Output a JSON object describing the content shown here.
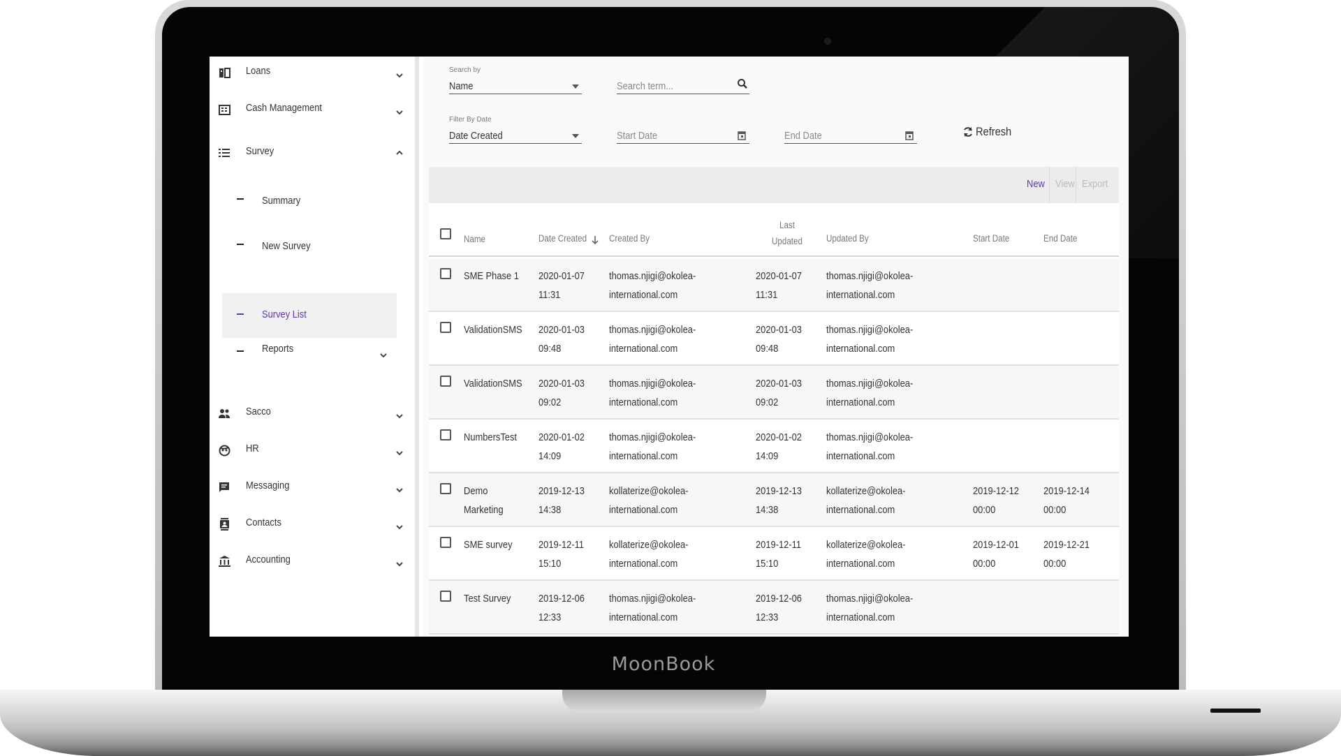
{
  "device": {
    "brand": "MoonBook"
  },
  "sidebar": {
    "items": [
      {
        "label": "Loans",
        "icon": "loans-book-icon"
      },
      {
        "label": "Cash Management",
        "icon": "cash-register-icon"
      },
      {
        "label": "Survey",
        "icon": "list-icon",
        "expanded": true
      },
      {
        "label": "Sacco",
        "icon": "group-icon"
      },
      {
        "label": "HR",
        "icon": "face-icon"
      },
      {
        "label": "Messaging",
        "icon": "message-icon"
      },
      {
        "label": "Contacts",
        "icon": "contacts-icon"
      },
      {
        "label": "Accounting",
        "icon": "bank-icon"
      }
    ],
    "survey_children": [
      {
        "label": "Summary"
      },
      {
        "label": "New Survey"
      },
      {
        "label": "Survey List",
        "active": true
      },
      {
        "label": "Reports",
        "has_children": true
      }
    ]
  },
  "filters": {
    "search_by_caption": "Search by",
    "search_by_value": "Name",
    "search_term_placeholder": "Search term...",
    "filter_by_date_caption": "Filter By Date",
    "filter_by_date_value": "Date Created",
    "start_date_placeholder": "Start Date",
    "end_date_placeholder": "End Date",
    "refresh_label": "Refresh"
  },
  "toolbar": {
    "new_label": "New",
    "view_label": "View",
    "export_label": "Export",
    "accent_color": "#5e35b1"
  },
  "table": {
    "columns": {
      "name": "Name",
      "date_created": "Date Created",
      "created_by": "Created By",
      "last_updated": "Last\nUpdated",
      "updated_by": "Updated By",
      "start_date": "Start Date",
      "end_date": "End Date"
    },
    "rows": [
      {
        "name": "SME Phase 1",
        "date_created": "2020-01-07\n11:31",
        "created_by": "thomas.njigi@okolea-\ninternational.com",
        "last_updated": "2020-01-07\n11:31",
        "updated_by": "thomas.njigi@okolea-\ninternational.com",
        "start_date": "",
        "end_date": ""
      },
      {
        "name": "ValidationSMS",
        "date_created": "2020-01-03\n09:48",
        "created_by": "thomas.njigi@okolea-\ninternational.com",
        "last_updated": "2020-01-03\n09:48",
        "updated_by": "thomas.njigi@okolea-\ninternational.com",
        "start_date": "",
        "end_date": ""
      },
      {
        "name": "ValidationSMS",
        "date_created": "2020-01-03\n09:02",
        "created_by": "thomas.njigi@okolea-\ninternational.com",
        "last_updated": "2020-01-03\n09:02",
        "updated_by": "thomas.njigi@okolea-\ninternational.com",
        "start_date": "",
        "end_date": ""
      },
      {
        "name": "NumbersTest",
        "date_created": "2020-01-02\n14:09",
        "created_by": "thomas.njigi@okolea-\ninternational.com",
        "last_updated": "2020-01-02\n14:09",
        "updated_by": "thomas.njigi@okolea-\ninternational.com",
        "start_date": "",
        "end_date": ""
      },
      {
        "name": "Demo\nMarketing",
        "date_created": "2019-12-13\n14:38",
        "created_by": "kollaterize@okolea-\ninternational.com",
        "last_updated": "2019-12-13\n14:38",
        "updated_by": "kollaterize@okolea-\ninternational.com",
        "start_date": "2019-12-12\n00:00",
        "end_date": "2019-12-14\n00:00"
      },
      {
        "name": "SME survey",
        "date_created": "2019-12-11\n15:10",
        "created_by": "kollaterize@okolea-\ninternational.com",
        "last_updated": "2019-12-11\n15:10",
        "updated_by": "kollaterize@okolea-\ninternational.com",
        "start_date": "2019-12-01\n00:00",
        "end_date": "2019-12-21\n00:00"
      },
      {
        "name": "Test Survey",
        "date_created": "2019-12-06\n12:33",
        "created_by": "thomas.njigi@okolea-\ninternational.com",
        "last_updated": "2019-12-06\n12:33",
        "updated_by": "thomas.njigi@okolea-\ninternational.com",
        "start_date": "",
        "end_date": ""
      }
    ]
  }
}
